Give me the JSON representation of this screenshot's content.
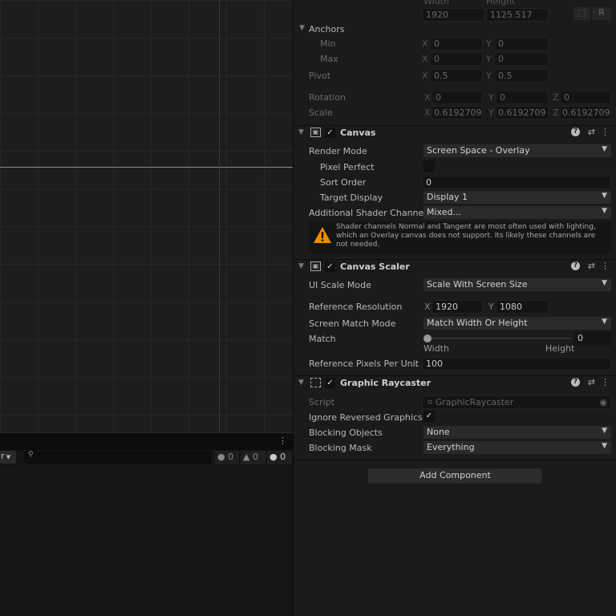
{
  "console": {
    "filter_label": "r",
    "search_placeholder": "",
    "errors": "0",
    "warnings": "0",
    "logs": "0"
  },
  "rect": {
    "width_label": "Width",
    "height_label": "Height",
    "width": "1920",
    "height": "1125.517",
    "r_button": "R",
    "anchors_label": "Anchors",
    "min_label": "Min",
    "max_label": "Max",
    "min_x": "0",
    "min_y": "0",
    "max_x": "0",
    "max_y": "0",
    "pivot_label": "Pivot",
    "pivot_x": "0.5",
    "pivot_y": "0.5",
    "rotation_label": "Rotation",
    "rot_x": "0",
    "rot_y": "0",
    "rot_z": "0",
    "scale_label": "Scale",
    "scale_x": "0.6192709",
    "scale_y": "0.6192709",
    "scale_z": "0.6192709"
  },
  "canvas": {
    "title": "Canvas",
    "render_mode_label": "Render Mode",
    "render_mode": "Screen Space - Overlay",
    "pixel_perfect_label": "Pixel Perfect",
    "pixel_perfect": false,
    "sort_order_label": "Sort Order",
    "sort_order": "0",
    "target_display_label": "Target Display",
    "target_display": "Display 1",
    "shader_label": "Additional Shader Channel",
    "shader": "Mixed...",
    "warning": "Shader channels Normal and Tangent are most often used with lighting, which an Overlay canvas does not support. Its likely these channels are not needed."
  },
  "scaler": {
    "title": "Canvas Scaler",
    "ui_scale_mode_label": "UI Scale Mode",
    "ui_scale_mode": "Scale With Screen Size",
    "ref_res_label": "Reference Resolution",
    "ref_x": "1920",
    "ref_y": "1080",
    "match_mode_label": "Screen Match Mode",
    "match_mode": "Match Width Or Height",
    "match_label": "Match",
    "match_value": "0",
    "match_min_label": "Width",
    "match_max_label": "Height",
    "ppu_label": "Reference Pixels Per Unit",
    "ppu": "100"
  },
  "raycaster": {
    "title": "Graphic Raycaster",
    "script_label": "Script",
    "script": "GraphicRaycaster",
    "ignore_label": "Ignore Reversed Graphics",
    "ignore": true,
    "blocking_objects_label": "Blocking Objects",
    "blocking_objects": "None",
    "blocking_mask_label": "Blocking Mask",
    "blocking_mask": "Everything"
  },
  "add_component": "Add Component",
  "axes": {
    "x": "X",
    "y": "Y",
    "z": "Z"
  },
  "icons": {
    "check": "✓",
    "help": "?",
    "kebab": "⋮",
    "dropdown": "▼",
    "presets": "⇄"
  }
}
